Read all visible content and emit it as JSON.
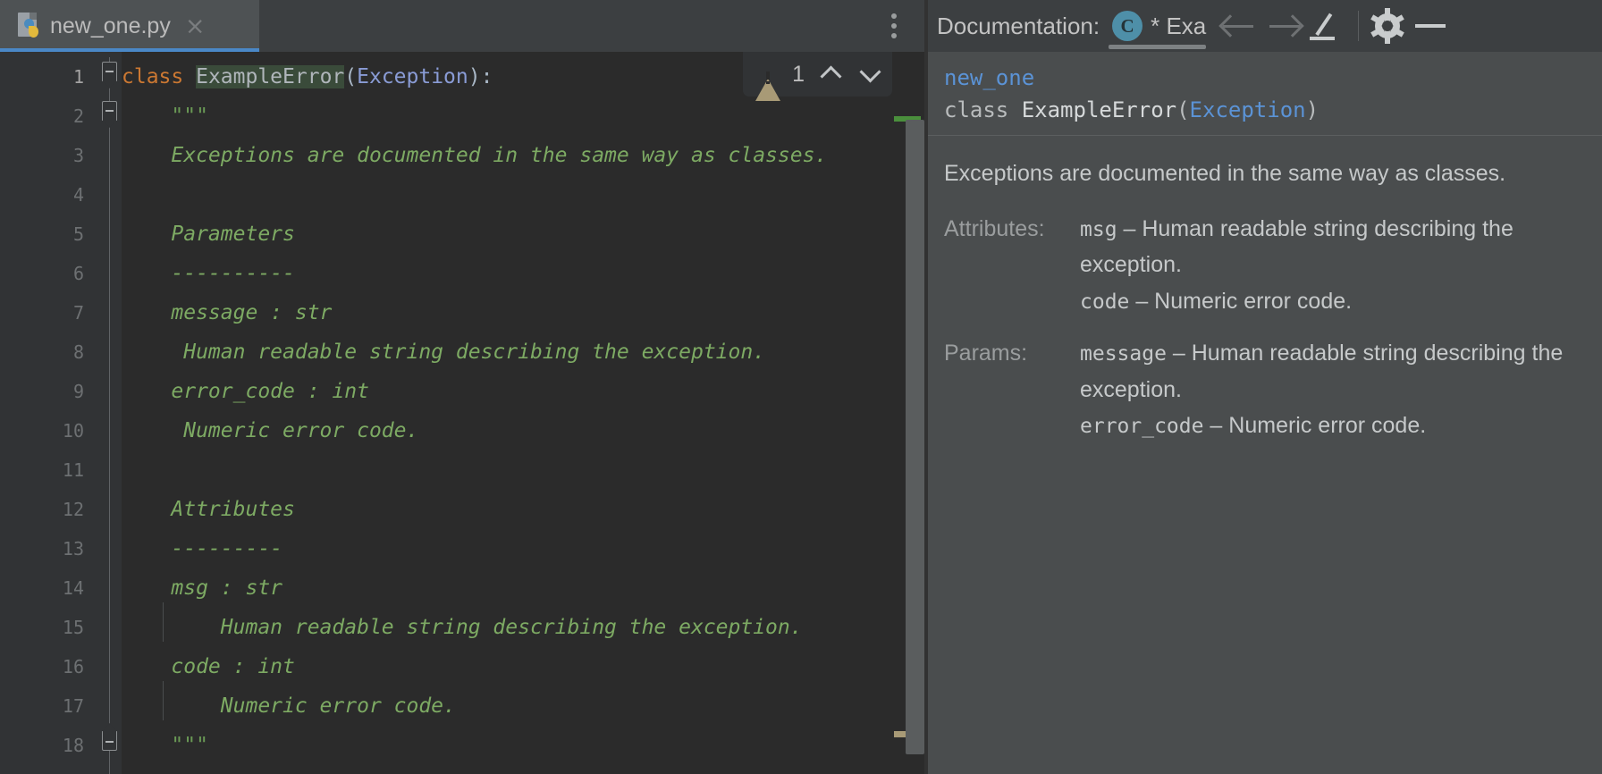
{
  "editor": {
    "tab": {
      "filename": "new_one.py",
      "icon": "python-file-icon",
      "close_label": "×"
    },
    "overflow_menu_icon": "more-vertical-icon",
    "inspection": {
      "warning_icon": "warning-triangle-icon",
      "warning_count": "1",
      "prev_icon": "chevron-up-icon",
      "next_icon": "chevron-down-icon"
    },
    "lines": [
      {
        "n": "1",
        "segments": [
          {
            "t": "class ",
            "c": "tok-kw"
          },
          {
            "t": "ExampleError",
            "c": "tok-cls"
          },
          {
            "t": "(",
            "c": "tok-paren"
          },
          {
            "t": "Exception",
            "c": "tok-base"
          },
          {
            "t": "):",
            "c": "tok-paren"
          }
        ]
      },
      {
        "n": "2",
        "segments": [
          {
            "t": "    \"\"\"",
            "c": "tok-docq"
          }
        ]
      },
      {
        "n": "3",
        "segments": [
          {
            "t": "    Exceptions are documented in the same way as classes.",
            "c": "tok-doc"
          }
        ]
      },
      {
        "n": "4",
        "segments": [
          {
            "t": "",
            "c": "tok-doc"
          }
        ]
      },
      {
        "n": "5",
        "segments": [
          {
            "t": "    Parameters",
            "c": "tok-doc"
          }
        ]
      },
      {
        "n": "6",
        "segments": [
          {
            "t": "    ----------",
            "c": "tok-doc"
          }
        ]
      },
      {
        "n": "7",
        "segments": [
          {
            "t": "    message : str",
            "c": "tok-doc"
          }
        ]
      },
      {
        "n": "8",
        "segments": [
          {
            "t": "     Human readable string describing the exception.",
            "c": "tok-doc"
          }
        ]
      },
      {
        "n": "9",
        "segments": [
          {
            "t": "    error_code : int",
            "c": "tok-doc"
          }
        ]
      },
      {
        "n": "10",
        "segments": [
          {
            "t": "     Numeric error code.",
            "c": "tok-doc"
          }
        ]
      },
      {
        "n": "11",
        "segments": [
          {
            "t": "",
            "c": "tok-doc"
          }
        ]
      },
      {
        "n": "12",
        "segments": [
          {
            "t": "    Attributes",
            "c": "tok-doc"
          }
        ]
      },
      {
        "n": "13",
        "segments": [
          {
            "t": "    ---------",
            "c": "tok-doc"
          }
        ]
      },
      {
        "n": "14",
        "segments": [
          {
            "t": "    msg : str",
            "c": "tok-doc"
          }
        ]
      },
      {
        "n": "15",
        "segments": [
          {
            "t": "        Human readable string describing the exception.",
            "c": "tok-doc"
          }
        ]
      },
      {
        "n": "16",
        "segments": [
          {
            "t": "    code : int",
            "c": "tok-doc"
          }
        ]
      },
      {
        "n": "17",
        "segments": [
          {
            "t": "        Numeric error code.",
            "c": "tok-doc"
          }
        ]
      },
      {
        "n": "18",
        "segments": [
          {
            "t": "    \"\"\"",
            "c": "tok-docq"
          }
        ]
      }
    ]
  },
  "documentation": {
    "header": {
      "title": "Documentation:",
      "tab_badge": "C",
      "tab_label": "* Exa",
      "back_icon": "arrow-left-icon",
      "forward_icon": "arrow-right-icon",
      "edit_icon": "pencil-icon",
      "settings_icon": "gear-icon",
      "minimize_icon": "minimize-icon"
    },
    "signature": {
      "module": "new_one",
      "keyword": "class ",
      "name": "ExampleError",
      "open_paren": "(",
      "base": "Exception",
      "close_paren": ")"
    },
    "description": "Exceptions are documented in the same way as classes.",
    "fields": [
      {
        "label": "Attributes:",
        "entries": [
          {
            "name": "msg",
            "dash": " – ",
            "text": "Human readable string describing the exception."
          },
          {
            "name": "code",
            "dash": " – ",
            "text": "Numeric error code."
          }
        ]
      },
      {
        "label": "Params:",
        "entries": [
          {
            "name": "message",
            "dash": " – ",
            "text": "Human readable string describing the exception."
          },
          {
            "name": "error_code",
            "dash": " – ",
            "text": "Numeric error code."
          }
        ]
      }
    ]
  },
  "colors": {
    "editor_bg": "#2b2b2b",
    "gutter_bg": "#313335",
    "chrome_bg": "#3c3f41",
    "doc_bg": "#4a4d4e",
    "tab_accent": "#4a88c7",
    "keyword": "#cc7832",
    "docstring": "#7daa63",
    "base_class": "#8a9cd6",
    "doc_link": "#5b93d6",
    "warning": "#a89a76",
    "vcs_added": "#4a8f3c",
    "class_badge": "#4e8fa8"
  }
}
